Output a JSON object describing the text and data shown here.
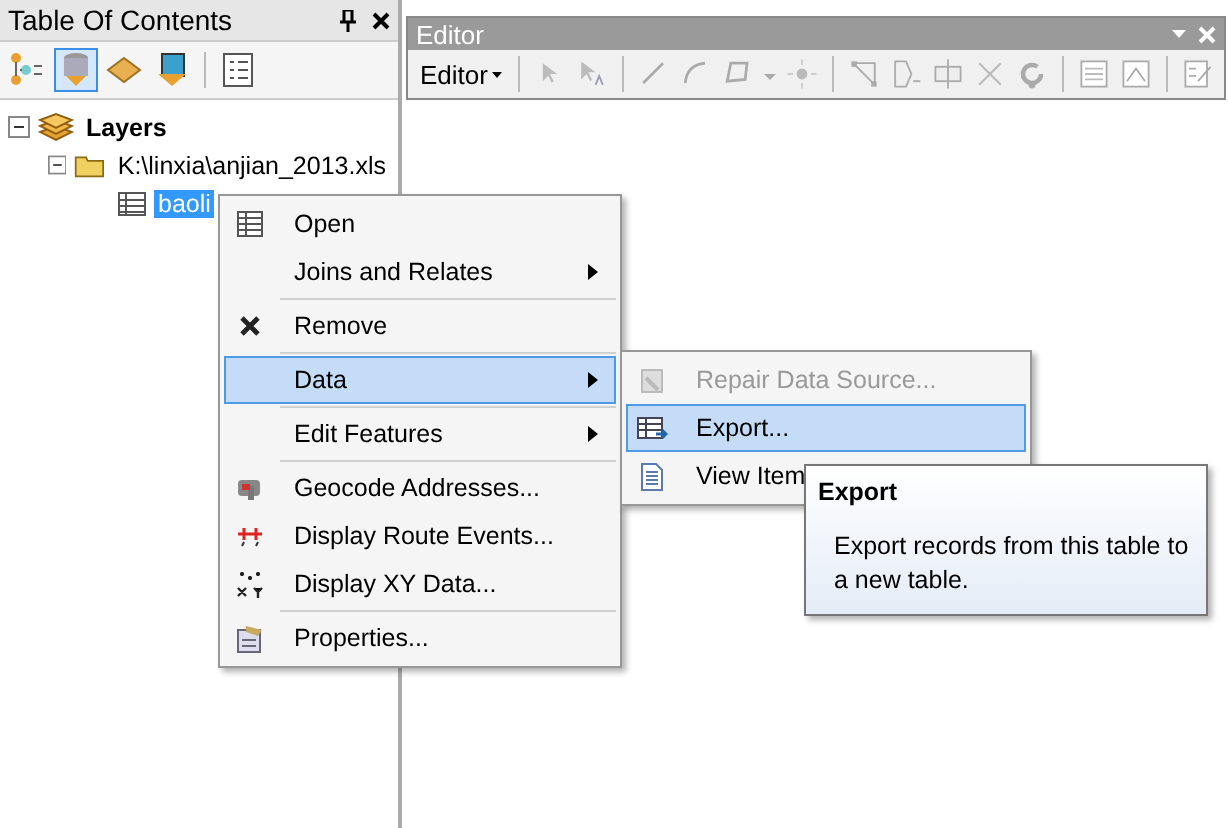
{
  "toc": {
    "title": "Table Of Contents",
    "tools": [
      {
        "selected": false
      },
      {
        "selected": true
      },
      {
        "selected": false
      },
      {
        "selected": false
      },
      {
        "selected": false
      }
    ]
  },
  "tree": [
    {
      "kind": "group",
      "label": "Layers",
      "expanded": true,
      "selected": false,
      "children": [
        {
          "kind": "folder",
          "label": "K:\\linxia\\anjian_2013.xls",
          "expanded": true,
          "selected": false,
          "children": [
            {
              "kind": "table",
              "label": "baoli",
              "selected": true
            }
          ]
        }
      ]
    }
  ],
  "editor": {
    "title": "Editor",
    "menu": "Editor"
  },
  "context_menu": [
    {
      "kind": "item",
      "label": "Open",
      "submenu": false,
      "selected": false
    },
    {
      "kind": "item",
      "label": "Joins and Relates",
      "submenu": true,
      "selected": false
    },
    {
      "kind": "separator"
    },
    {
      "kind": "item",
      "label": "Remove",
      "submenu": false,
      "selected": false
    },
    {
      "kind": "separator"
    },
    {
      "kind": "item",
      "label": "Data",
      "submenu": true,
      "selected": true
    },
    {
      "kind": "separator"
    },
    {
      "kind": "item",
      "label": "Edit Features",
      "submenu": true,
      "selected": false
    },
    {
      "kind": "separator"
    },
    {
      "kind": "item",
      "label": "Geocode Addresses...",
      "submenu": false,
      "selected": false
    },
    {
      "kind": "item",
      "label": "Display Route Events...",
      "submenu": false,
      "selected": false
    },
    {
      "kind": "item",
      "label": "Display XY Data...",
      "submenu": false,
      "selected": false
    },
    {
      "kind": "separator"
    },
    {
      "kind": "item",
      "label": "Properties...",
      "submenu": false,
      "selected": false
    }
  ],
  "submenu": [
    {
      "label": "Repair Data Source...",
      "disabled": true,
      "selected": false
    },
    {
      "label": "Export...",
      "disabled": false,
      "selected": true
    },
    {
      "label": "View Item",
      "disabled": false,
      "selected": false
    }
  ],
  "tooltip": {
    "title": "Export",
    "text": "Export records from this table to a new table."
  }
}
